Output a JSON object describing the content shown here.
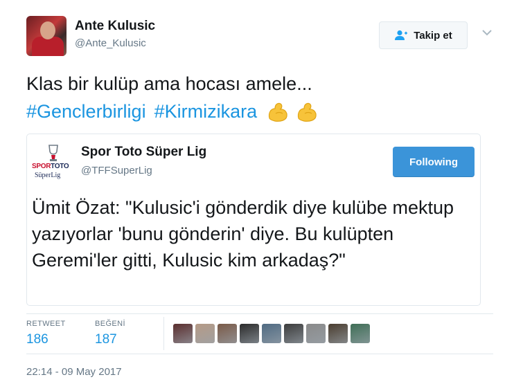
{
  "author": {
    "name": "Ante Kulusic",
    "handle": "@Ante_Kulusic"
  },
  "follow_button": {
    "label": "Takip et",
    "icon": "add-user-icon"
  },
  "tweet": {
    "text": "Klas bir kulüp ama hocası amele...",
    "hashtags": [
      "#Genclerbirligi",
      "#Kirmizikara"
    ],
    "emoji": [
      "flexed-biceps",
      "flexed-biceps"
    ]
  },
  "quoted_tweet": {
    "logo_brand_spor": "SPOR",
    "logo_brand_toto": "TOTO",
    "logo_sub": "SüperLig",
    "name": "Spor Toto Süper Lig",
    "handle": "@TFFSuperLig",
    "following_label": "Following",
    "text": "Ümit Özat: \"Kulusic'i gönderdik diye kulübe mektup yazıyorlar 'bunu gönderin' diye. Bu kulüpten Geremi'ler gitti, Kulusic kim arkadaş?\""
  },
  "stats": {
    "retweet_label": "RETWEET",
    "retweet_count": "186",
    "like_label": "BEĞENİ",
    "like_count": "187"
  },
  "likers": [
    {
      "color": "#5a2e2e"
    },
    {
      "color": "#b59a86"
    },
    {
      "color": "#7a5a48"
    },
    {
      "color": "#2b2b2b"
    },
    {
      "color": "#4f6a82"
    },
    {
      "color": "#3c3c3c"
    },
    {
      "color": "#8a8a8a"
    },
    {
      "color": "#4a3d2f"
    },
    {
      "color": "#3f6e56"
    }
  ],
  "timestamp": "22:14 - 09 May 2017",
  "colors": {
    "link": "#1b95e0",
    "following_button": "#3b94d9",
    "muted": "#657786"
  }
}
